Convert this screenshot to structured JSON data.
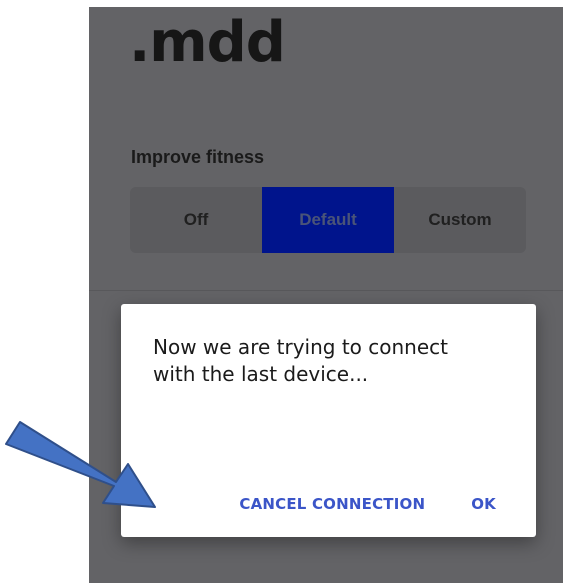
{
  "app": {
    "logo_text": ".mdd"
  },
  "settings": {
    "section_label": "Improve fitness",
    "options": [
      {
        "label": "Off"
      },
      {
        "label": "Default"
      },
      {
        "label": "Custom"
      }
    ],
    "selected": "Default"
  },
  "dialog": {
    "message": "Now we are trying to connect with the last device...",
    "cancel_label": "CANCEL CONNECTION",
    "ok_label": "OK"
  },
  "annotation": {
    "icon": "arrow-icon",
    "color": "#4472c4",
    "outline": "#2f4f8a"
  },
  "colors": {
    "overlay": "#636366",
    "selected_segment": "#00148c",
    "dialog_button": "#3b55c8"
  }
}
